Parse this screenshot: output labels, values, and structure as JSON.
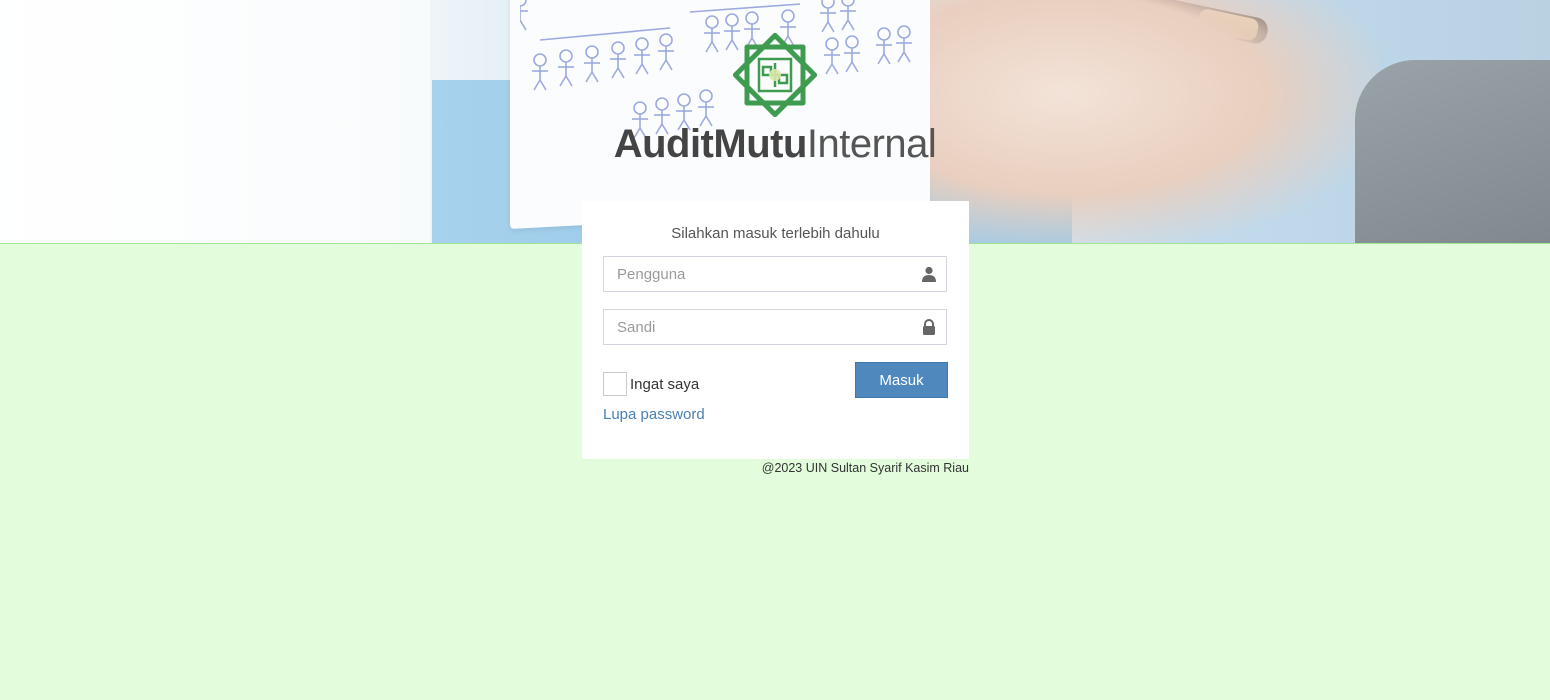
{
  "brand": {
    "logo_icon": "uin-suska-emblem-icon",
    "name_bold": "AuditMutu",
    "name_light": "Internal",
    "accent_color": "#3f9b4f"
  },
  "login": {
    "title": "Silahkan masuk terlebih dahulu",
    "username_placeholder": "Pengguna",
    "username_icon": "user-icon",
    "password_placeholder": "Sandi",
    "password_icon": "lock-icon",
    "remember_label": "Ingat saya",
    "submit_label": "Masuk",
    "forgot_label": "Lupa password",
    "button_color": "#4f88bd",
    "link_color": "#4a7fb5"
  },
  "footer": {
    "copyright": "@2023 UIN Sultan Syarif Kasim Riau"
  },
  "theme": {
    "background": "#e2fcdc"
  }
}
